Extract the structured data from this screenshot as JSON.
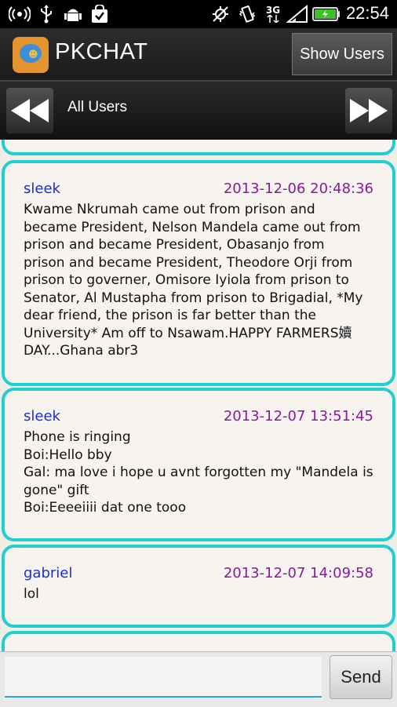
{
  "status_bar": {
    "time": "22:54",
    "network": "3G",
    "icons": [
      "wifi-hotspot-icon",
      "usb-icon",
      "android-debug-icon",
      "shopping-bag-icon",
      "gps-icon",
      "vibrate-icon",
      "signal-icon",
      "battery-icon"
    ]
  },
  "app_bar": {
    "title": "PKCHAT",
    "show_users_label": "Show Users"
  },
  "nav_bar": {
    "title": "All Users",
    "prev_icon": "rewind-icon",
    "next_icon": "fast-forward-icon"
  },
  "messages": [
    {
      "user": "sleek",
      "time": "2013-12-06 20:48:36",
      "text": "Kwame Nkrumah came out from prison and\nbecame President, Nelson Mandela came out from\nprison and became President, Obasanjo from\nprison and became President, Theodore Orji from\nprison to governer, Omisore Iyiola from prison to\nSenator, Al Mustapha from prison to Brigadial, *My\ndear friend, the prison is far better than the\nUniversity* Am off to Nsawam.HAPPY FARMERS嬻\nDAY...Ghana abr3"
    },
    {
      "user": "sleek",
      "time": "2013-12-07 13:51:45",
      "text": "Phone is ringing\nBoi:Hello bby\nGal: ma love i hope u avnt forgotten my \"Mandela is\ngone\" gift\nBoi:Eeeeiiii dat one tooo"
    },
    {
      "user": "gabriel",
      "time": "2013-12-07 14:09:58",
      "text": "lol"
    }
  ],
  "composer": {
    "value": "",
    "send_label": "Send"
  },
  "colors": {
    "accent": "#22cfd0",
    "username": "#1b2fd0",
    "timestamp": "#8a1a9c",
    "input_underline": "#2ea3d8"
  }
}
